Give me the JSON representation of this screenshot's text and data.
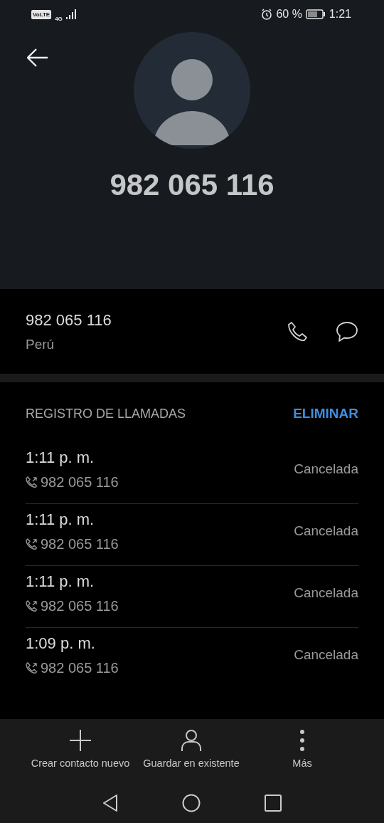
{
  "status_bar": {
    "volte": "VoLTE",
    "network": "4G",
    "battery": "60 %",
    "time": "1:21"
  },
  "header": {
    "number": "982 065 116"
  },
  "contact": {
    "number": "982 065 116",
    "location": "Perú"
  },
  "call_log": {
    "title": "REGISTRO DE LLAMADAS",
    "action": "ELIMINAR",
    "rows": [
      {
        "time": "1:11 p. m.",
        "number": "982 065 116",
        "status": "Cancelada"
      },
      {
        "time": "1:11 p. m.",
        "number": "982 065 116",
        "status": "Cancelada"
      },
      {
        "time": "1:11 p. m.",
        "number": "982 065 116",
        "status": "Cancelada"
      },
      {
        "time": "1:09 p. m.",
        "number": "982 065 116",
        "status": "Cancelada"
      }
    ]
  },
  "actions": [
    {
      "kind": "add",
      "label": "Crear contacto nuevo"
    },
    {
      "kind": "person",
      "label": "Guardar en existente"
    },
    {
      "kind": "more",
      "label": "Más"
    }
  ]
}
